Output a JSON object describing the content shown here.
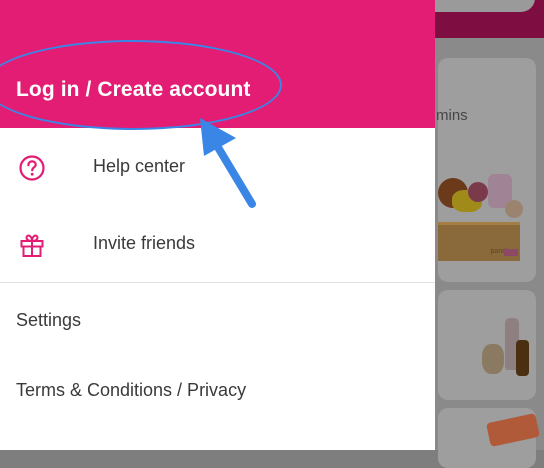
{
  "drawer": {
    "header": {
      "login_label": "Log in / Create account"
    },
    "items": [
      {
        "label": "Help center",
        "icon": "question-circle-icon"
      },
      {
        "label": "Invite friends",
        "icon": "gift-icon"
      }
    ],
    "secondary_items": [
      {
        "label": "Settings"
      },
      {
        "label": "Terms & Conditions / Privacy"
      }
    ]
  },
  "background": {
    "eta_fragment": "mins",
    "crate_label": "panda"
  },
  "colors": {
    "brand": "#e31c74",
    "annotation": "#3a86e6"
  }
}
